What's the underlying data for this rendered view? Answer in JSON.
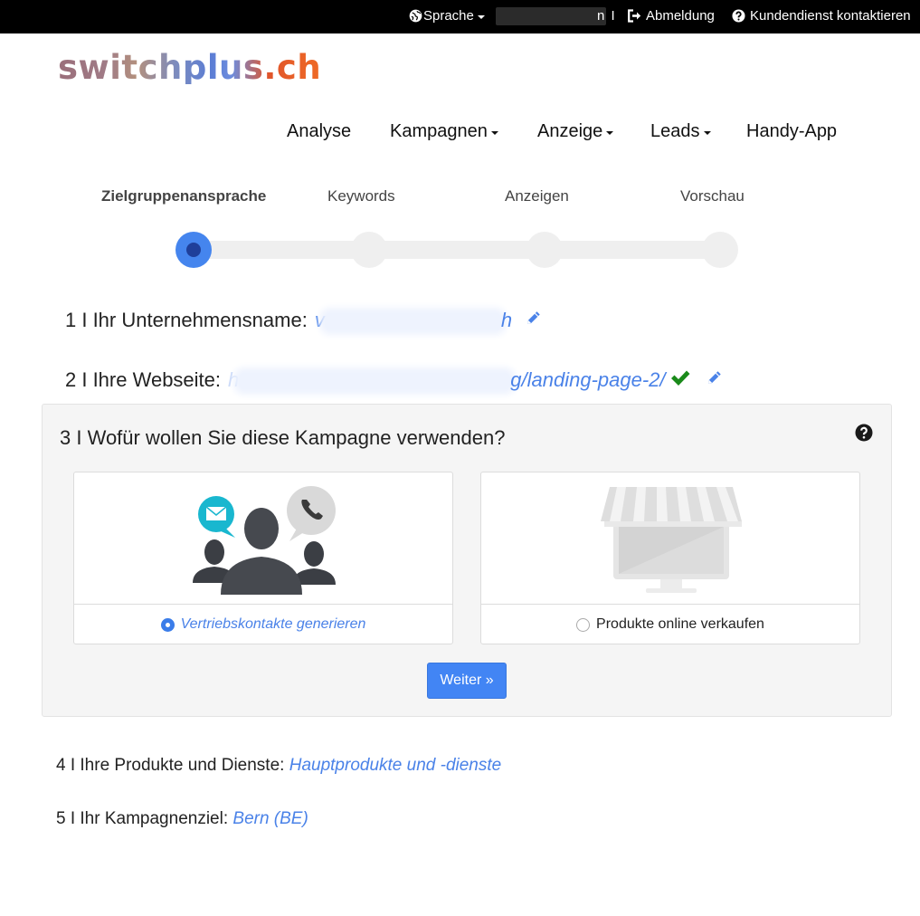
{
  "topbar": {
    "language_label": "Sprache",
    "user_tail": "n",
    "separator": "I",
    "logout_label": "Abmeldung",
    "support_label": "Kundendienst kontaktieren"
  },
  "logo": {
    "text": "switchplus.ch"
  },
  "nav": {
    "items": [
      {
        "label": "Analyse"
      },
      {
        "label": "Kampagnen"
      },
      {
        "label": "Anzeige"
      },
      {
        "label": "Leads"
      },
      {
        "label": "Handy-App"
      }
    ]
  },
  "wizard": {
    "steps": [
      {
        "label": "Zielgruppenansprache",
        "active": true
      },
      {
        "label": "Keywords"
      },
      {
        "label": "Anzeigen"
      },
      {
        "label": "Vorschau"
      }
    ]
  },
  "form": {
    "company": {
      "label": "1 I Ihr Unternehmensname:",
      "value_start": "v",
      "value_end": "h"
    },
    "website": {
      "label": "2 I Ihre Webseite:",
      "value_start": "h",
      "value_end": "g/landing-page-2/"
    },
    "purpose": {
      "title": "3 I Wofür wollen Sie diese Kampagne verwenden?",
      "options": [
        {
          "label": "Vertriebskontakte generieren",
          "selected": true
        },
        {
          "label": "Produkte online verkaufen",
          "selected": false
        }
      ],
      "button_label": "Weiter »"
    },
    "products": {
      "label": "4 I Ihre Produkte und Dienste:",
      "value": "Hauptprodukte und -dienste"
    },
    "target": {
      "label": "5 I Ihr Kampagnenziel:",
      "value": "Bern (BE)"
    }
  },
  "colors": {
    "accent": "#4285f4",
    "link": "#4a82e8",
    "check": "#1a8a1a",
    "topbar": "#000000"
  }
}
